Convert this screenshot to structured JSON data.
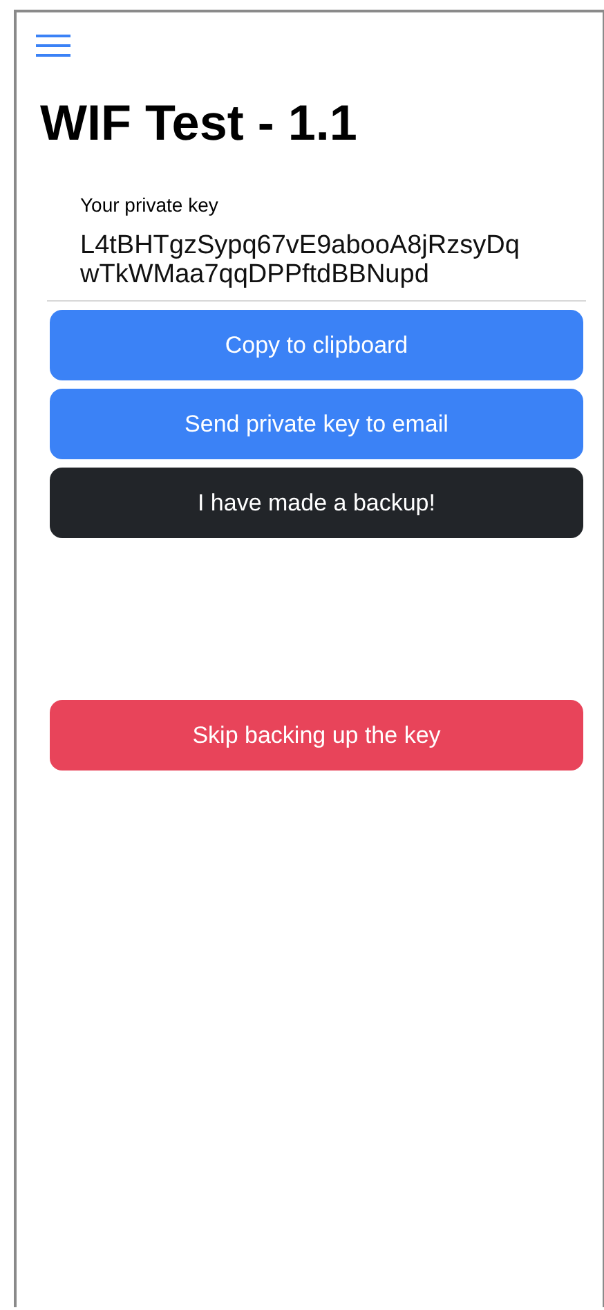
{
  "title": "WIF Test - 1.1",
  "key_label": "Your private key",
  "key_lines": [
    "L4tBHTgzSypq67vE9abooA8jRzsyDq",
    "wTkWMaa7qqDPPftdBBNupd"
  ],
  "buttons": [
    {
      "label": "Copy to clipboard",
      "kind": "primary"
    },
    {
      "label": "Send private key to email",
      "kind": "primary"
    },
    {
      "label": "I have made a backup!",
      "kind": "dark"
    }
  ],
  "skip_button": {
    "label": "Skip backing up the key",
    "kind": "danger"
  }
}
